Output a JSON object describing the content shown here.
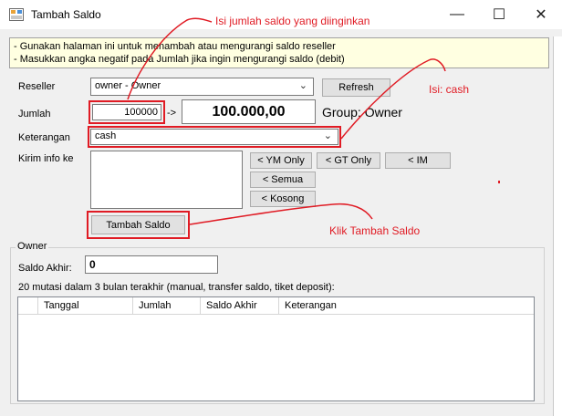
{
  "window": {
    "title": "Tambah Saldo",
    "minimize_glyph": "—",
    "maximize_glyph": "☐",
    "close_glyph": "✕"
  },
  "info": {
    "line1": "- Gunakan halaman ini untuk menambah atau mengurangi saldo reseller",
    "line2": "- Masukkan angka negatif pada Jumlah jika ingin mengurangi saldo (debit)"
  },
  "form": {
    "reseller_label": "Reseller",
    "reseller_value": "owner - Owner",
    "refresh_label": "Refresh",
    "jumlah_label": "Jumlah",
    "jumlah_value": "100000",
    "arrow": "->",
    "amount_display": "100.000,00",
    "group_text": "Group: Owner",
    "keterangan_label": "Keterangan",
    "keterangan_value": "cash",
    "kirim_label": "Kirim info ke",
    "btn_ym": "< YM Only",
    "btn_gt": "< GT Only",
    "btn_im": "< IM",
    "btn_semua": "< Semua",
    "btn_kosong": "< Kosong",
    "submit_label": "Tambah Saldo"
  },
  "owner_group": {
    "title": "Owner",
    "saldo_label": "Saldo Akhir:",
    "saldo_value": "0",
    "mutasi_caption": "20 mutasi dalam 3 bulan terakhir (manual, transfer saldo, tiket deposit):",
    "columns": [
      "Tanggal",
      "Jumlah",
      "Saldo Akhir",
      "Keterangan"
    ]
  },
  "annotations": {
    "jumlah": "Isi jumlah saldo yang diinginkan",
    "cash": "Isi: cash",
    "klik": "Klik Tambah Saldo"
  },
  "colors": {
    "annotation": "#e01b24",
    "info_bg": "#ffffe1",
    "window_bg": "#f0f0f0"
  }
}
